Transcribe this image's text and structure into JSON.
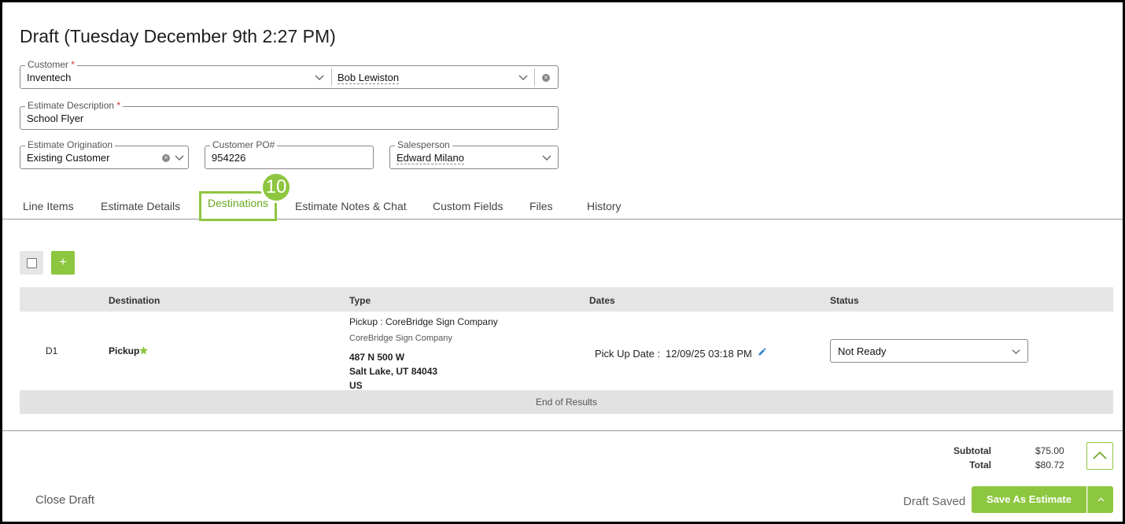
{
  "header": {
    "title": "Draft (Tuesday December 9th 2:27 PM)"
  },
  "form": {
    "customer_label": "Customer",
    "required_mark": "*",
    "customer_value": "Inventech",
    "contact_value": "Bob Lewiston",
    "description_label": "Estimate Description",
    "description_value": "School Flyer",
    "origination_label": "Estimate Origination",
    "origination_value": "Existing Customer",
    "po_label": "Customer PO#",
    "po_value": "954226",
    "salesperson_label": "Salesperson",
    "salesperson_value": "Edward Milano"
  },
  "tabs": [
    "Line Items",
    "Estimate Details",
    "Destinations",
    "Estimate Notes & Chat",
    "Custom Fields",
    "Files",
    "History"
  ],
  "active_tab": "Destinations",
  "step_badge": "10",
  "toolbar": {
    "add_label": "+"
  },
  "table": {
    "headers": {
      "destination": "Destination",
      "type": "Type",
      "dates": "Dates",
      "status": "Status"
    },
    "rows": [
      {
        "id": "D1",
        "destination": "Pickup",
        "type_line": "Pickup : CoreBridge Sign Company",
        "company": "CoreBridge Sign Company",
        "address1": "487 N 500 W",
        "address2": "Salt Lake, UT 84043",
        "country": "US",
        "date_label": "Pick Up Date :",
        "date_value": "12/09/25 03:18 PM",
        "status": "Not Ready"
      }
    ],
    "end_text": "End of Results"
  },
  "totals": {
    "subtotal_label": "Subtotal",
    "subtotal_value": "$75.00",
    "total_label": "Total",
    "total_value": "$80.72"
  },
  "footer": {
    "close_label": "Close Draft",
    "saved_label": "Draft Saved",
    "save_label": "Save As Estimate"
  },
  "colors": {
    "accent": "#8dc63f",
    "required": "#d32f2f"
  }
}
